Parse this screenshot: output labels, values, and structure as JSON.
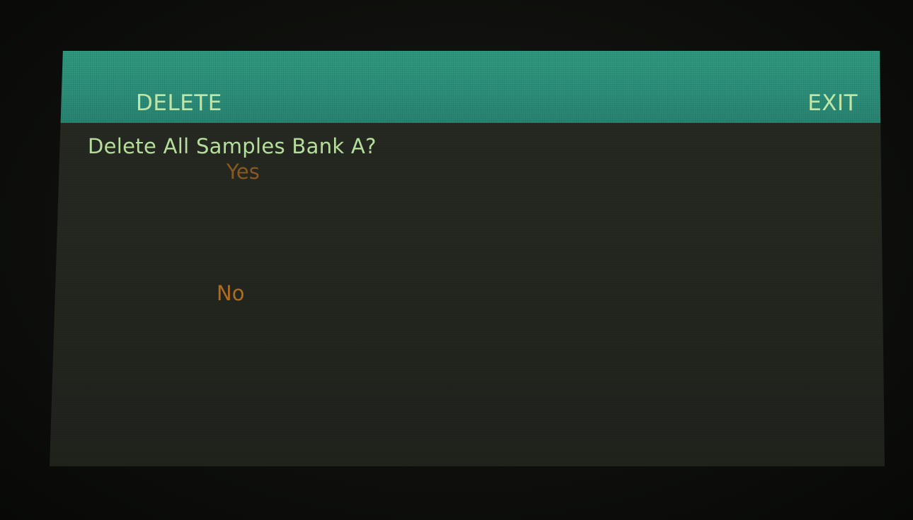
{
  "header": {
    "left_softkey": "DELETE",
    "right_softkey": "EXIT"
  },
  "dialog": {
    "prompt": "Delete All Samples Bank A?",
    "options": [
      {
        "label": "Yes",
        "selected": false
      },
      {
        "label": "No",
        "selected": true
      }
    ]
  },
  "colors": {
    "header_bar": "#2c8f79",
    "header_text": "#bfe6a8",
    "prompt_text": "#b9e29e",
    "option_text": "#b06e1e",
    "screen_bg": "#23271f"
  }
}
